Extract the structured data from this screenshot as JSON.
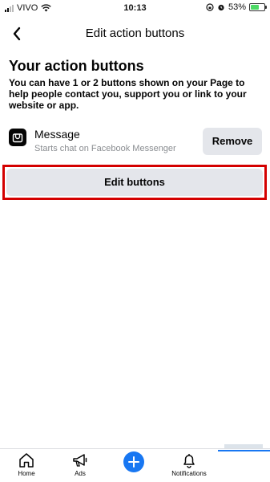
{
  "status_bar": {
    "carrier": "VIVO",
    "time": "10:13",
    "battery": "53%"
  },
  "header": {
    "title": "Edit action buttons"
  },
  "section": {
    "title": "Your action buttons",
    "description": "You can have 1 or 2 buttons shown on your Page to help people contact you, support you or link to your website or app."
  },
  "actions": [
    {
      "name": "Message",
      "subtitle": "Starts chat on Facebook Messenger",
      "remove_label": "Remove",
      "icon": "messenger-bag-icon"
    }
  ],
  "edit_button": {
    "label": "Edit buttons",
    "highlight_color": "#d40000"
  },
  "bottom_nav": {
    "items": [
      {
        "label": "Home",
        "icon": "home-icon"
      },
      {
        "label": "Ads",
        "icon": "megaphone-icon"
      },
      {
        "label": "",
        "icon": "plus-icon"
      },
      {
        "label": "Notifications",
        "icon": "bell-icon"
      }
    ]
  },
  "colors": {
    "accent": "#1877f2",
    "button_bg": "#e4e6eb",
    "subtext": "#8a8d91"
  }
}
